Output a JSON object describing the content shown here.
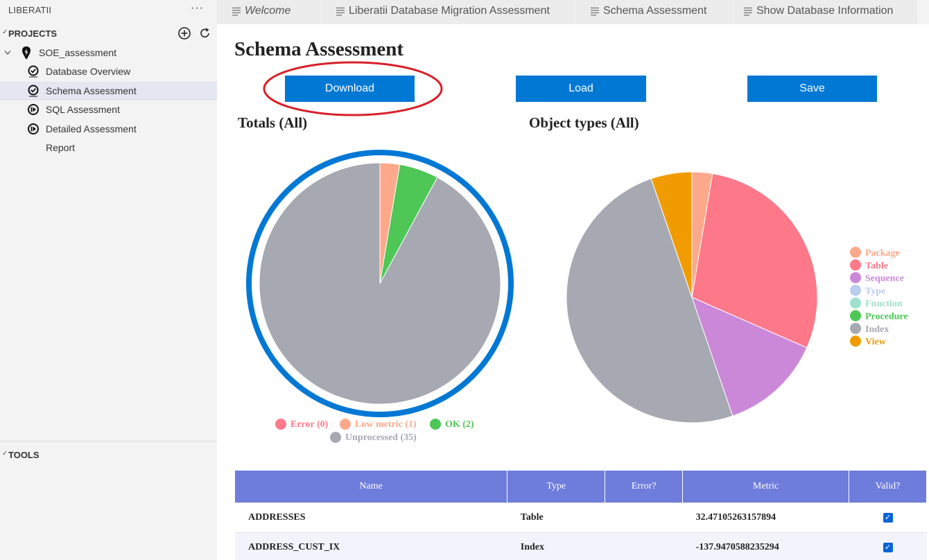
{
  "sidebar": {
    "title": "LIBERATII",
    "more": "···",
    "projects_label": "PROJECTS",
    "project_name": "SOE_assessment",
    "items": [
      {
        "label": "Database Overview",
        "icon": "check-circle-icon"
      },
      {
        "label": "Schema Assessment",
        "icon": "check-circle-icon",
        "selected": true
      },
      {
        "label": "SQL Assessment",
        "icon": "play-circle-icon"
      },
      {
        "label": "Detailed Assessment",
        "icon": "play-circle-icon"
      },
      {
        "label": "Report",
        "icon": ""
      }
    ],
    "tools_label": "TOOLS"
  },
  "tabs": [
    {
      "label": "Welcome",
      "italic": true
    },
    {
      "label": "Liberatii Database Migration Assessment"
    },
    {
      "label": "Schema Assessment"
    },
    {
      "label": "Show Database Information"
    }
  ],
  "main": {
    "title": "Schema Assessment",
    "buttons": {
      "download": "Download",
      "load": "Load",
      "save": "Save"
    },
    "totals_title": "Totals (All)",
    "object_types_title": "Object types (All)"
  },
  "chart_data": [
    {
      "type": "pie",
      "title": "Totals (All)",
      "categories": [
        "Error (0)",
        "Low metric (1)",
        "OK (2)",
        "Unprocessed (35)"
      ],
      "values": [
        0,
        1,
        2,
        35
      ],
      "colors": [
        "#ff7b8c",
        "#fca98b",
        "#4ec756",
        "#a6a9b1"
      ],
      "legend": "bottom"
    },
    {
      "type": "pie",
      "title": "Object types (All)",
      "categories": [
        "Package",
        "Table",
        "Sequence",
        "Type",
        "Function",
        "Procedure",
        "Index",
        "View"
      ],
      "values": [
        1,
        11,
        5,
        0,
        0,
        0,
        19,
        2
      ],
      "colors": [
        "#fca98b",
        "#fd7889",
        "#cc88d8",
        "#bccdee",
        "#9fe1cc",
        "#4ec756",
        "#a6a9b1",
        "#f09c00"
      ],
      "legend": "right"
    }
  ],
  "table": {
    "headers": [
      "Name",
      "Type",
      "Error?",
      "Metric",
      "Valid?"
    ],
    "rows": [
      {
        "name": "ADDRESSES",
        "type": "Table",
        "error": "",
        "metric": "32.47105263157894",
        "valid": true
      },
      {
        "name": "ADDRESS_CUST_IX",
        "type": "Index",
        "error": "",
        "metric": "-137.9470588235294",
        "valid": true
      }
    ]
  }
}
